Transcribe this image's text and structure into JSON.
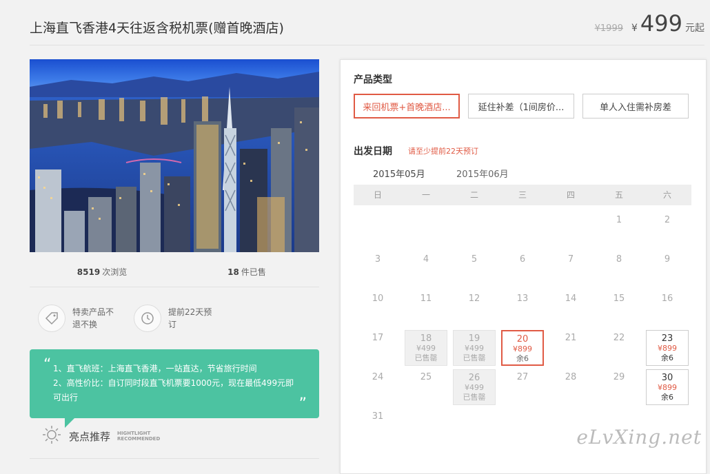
{
  "header": {
    "title": "上海直飞香港4天往返含税机票(赠首晚酒店)",
    "old_price": "¥1999",
    "currency": "¥",
    "price": "499",
    "price_suffix": "元起"
  },
  "stats": {
    "views_num": "8519",
    "views_label": "次浏览",
    "sold_num": "18",
    "sold_label": "件已售"
  },
  "features": [
    {
      "icon": "tag-icon",
      "text": "特卖产品不退不换"
    },
    {
      "icon": "clock-history-icon",
      "text": "提前22天预订"
    }
  ],
  "highlight": {
    "open_quote": "“",
    "close_quote": "”",
    "line1": "1、直飞航班：上海直飞香港，一站直达，节省旅行时间",
    "line2": "2、高性价比：自订同时段直飞机票要1000元，现在最低499元即可出行",
    "label": "亮点推荐",
    "label_en1": "HIGHTLIGHT",
    "label_en2": "RECOMMENDED"
  },
  "panel": {
    "product_type_label": "产品类型",
    "options": [
      "来回机票+首晚酒店...",
      "延住补差（1间房价...",
      "单人入住需补房差"
    ],
    "selected_option": 0,
    "date_label": "出发日期",
    "date_note": "请至少提前22天预订",
    "months": [
      "2015年05月",
      "2015年06月"
    ],
    "weekdays": [
      "日",
      "一",
      "二",
      "三",
      "四",
      "五",
      "六"
    ]
  },
  "calendar": {
    "first_weekday": 5,
    "days": 31,
    "special": {
      "18": {
        "state": "sold",
        "price": "¥499",
        "status": "已售罄"
      },
      "19": {
        "state": "sold",
        "price": "¥499",
        "status": "已售罄"
      },
      "20": {
        "state": "selected",
        "price": "¥899",
        "status": "余6"
      },
      "23": {
        "state": "avail",
        "price": "¥899",
        "status": "余6"
      },
      "26": {
        "state": "sold",
        "price": "¥499",
        "status": "已售罄"
      },
      "30": {
        "state": "avail",
        "price": "¥899",
        "status": "余6"
      }
    }
  },
  "watermark": "eLvXing.net",
  "colors": {
    "accent": "#e05a44",
    "highlight": "#4cc3a1"
  }
}
